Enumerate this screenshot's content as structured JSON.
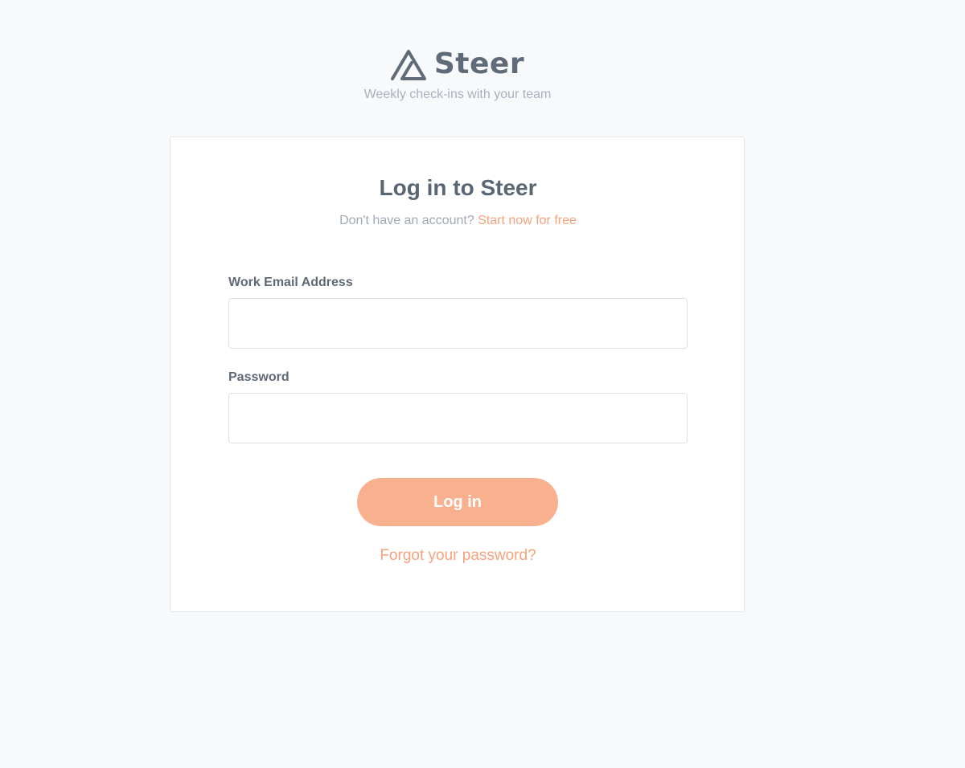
{
  "brand": {
    "name": "Steer",
    "tagline": "Weekly check-ins with your team",
    "logo_icon": "steer-triangle-logo-icon"
  },
  "login_card": {
    "title": "Log in to Steer",
    "signup_prompt": "Don't have an account?",
    "signup_link": "Start now for free",
    "email": {
      "label": "Work Email Address",
      "value": "",
      "placeholder": ""
    },
    "password": {
      "label": "Password",
      "value": "",
      "placeholder": ""
    },
    "login_button": "Log in",
    "forgot_link": "Forgot your password?"
  },
  "colors": {
    "background": "#f8f9fb",
    "accent": "#f5a27d",
    "button": "#f8b08e",
    "heading": "#5a6673"
  }
}
